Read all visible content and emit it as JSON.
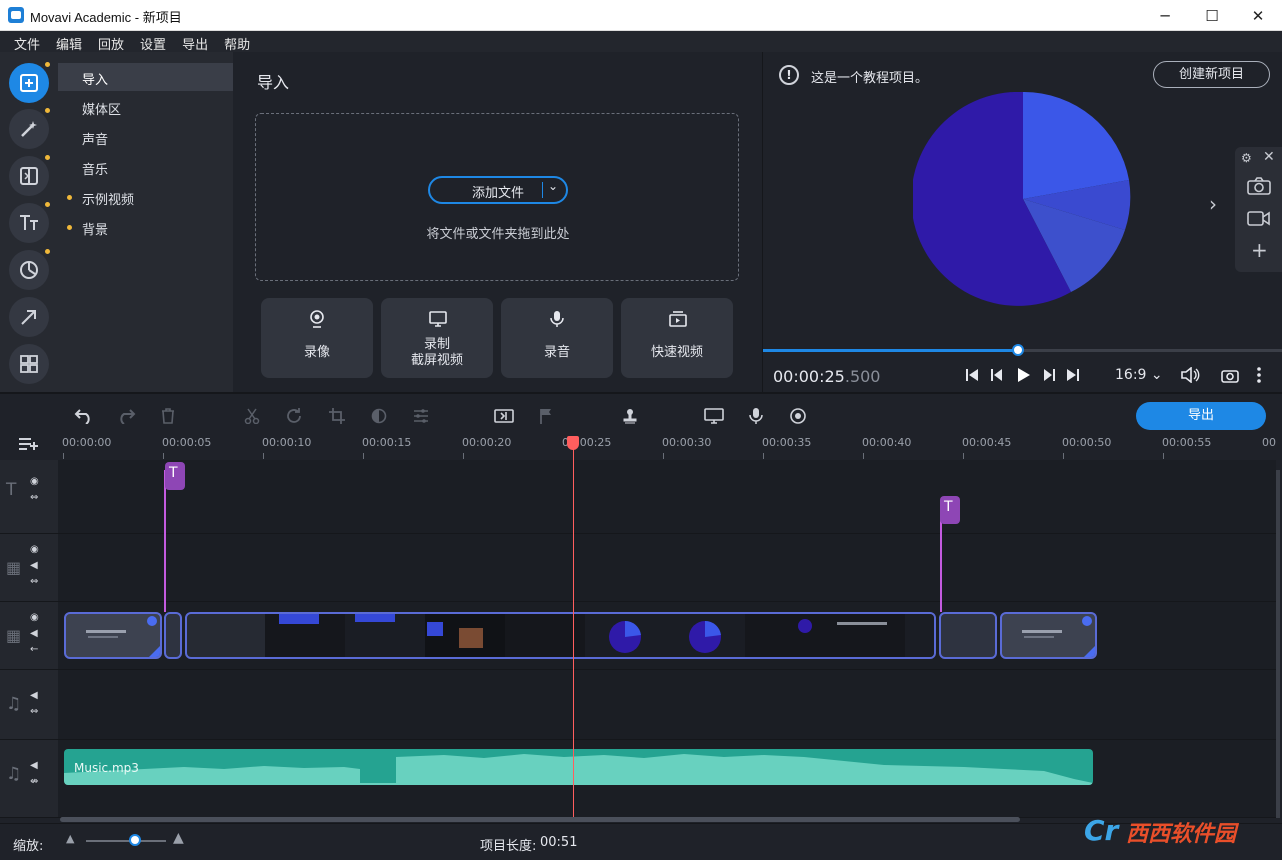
{
  "window": {
    "title": "Movavi Academic - 新项目",
    "minimize": "─",
    "maximize": "☐",
    "close": "✕"
  },
  "menu": [
    "文件",
    "编辑",
    "回放",
    "设置",
    "导出",
    "帮助"
  ],
  "import_nav": {
    "items": [
      {
        "label": "导入",
        "active": true,
        "dot": false
      },
      {
        "label": "媒体区",
        "active": false,
        "dot": false
      },
      {
        "label": "声音",
        "active": false,
        "dot": false
      },
      {
        "label": "音乐",
        "active": false,
        "dot": false
      },
      {
        "label": "示例视频",
        "active": false,
        "dot": true
      },
      {
        "label": "背景",
        "active": false,
        "dot": true
      }
    ]
  },
  "import_panel": {
    "title": "导入",
    "add_files": "添加文件",
    "drop_hint": "将文件或文件夹拖到此处",
    "capture": [
      {
        "line1": "录像",
        "line2": ""
      },
      {
        "line1": "录制",
        "line2": "截屏视频"
      },
      {
        "line1": "录音",
        "line2": ""
      },
      {
        "line1": "快速视频",
        "line2": ""
      }
    ]
  },
  "preview": {
    "info": "这是一个教程项目。",
    "new_project": "创建新项目",
    "timecode_main": "00:00:25",
    "timecode_ms": ".500",
    "ratio": "16:9 ⌄",
    "progress": 0.49,
    "pie_colors": [
      "#3b57e8",
      "#3a4ad0",
      "#3d50cc",
      "#2f1aa8"
    ]
  },
  "toolbar": {
    "export": "导出"
  },
  "ruler": [
    "00:00:00",
    "00:00:05",
    "00:00:10",
    "00:00:15",
    "00:00:20",
    "00:00:25",
    "00:00:30",
    "00:00:35",
    "00:00:40",
    "00:00:45",
    "00:00:50",
    "00:00:55",
    "00"
  ],
  "audio": {
    "name": "Music.mp3"
  },
  "status": {
    "zoom_label": "缩放:",
    "length_label": "项目长度:",
    "length_value": "00:51"
  },
  "watermark": "西西软件园",
  "colors": {
    "accent": "#1e88e5",
    "playhead": "#ff5e5e",
    "audio": "#25a391",
    "marker": "#8e46b5"
  }
}
